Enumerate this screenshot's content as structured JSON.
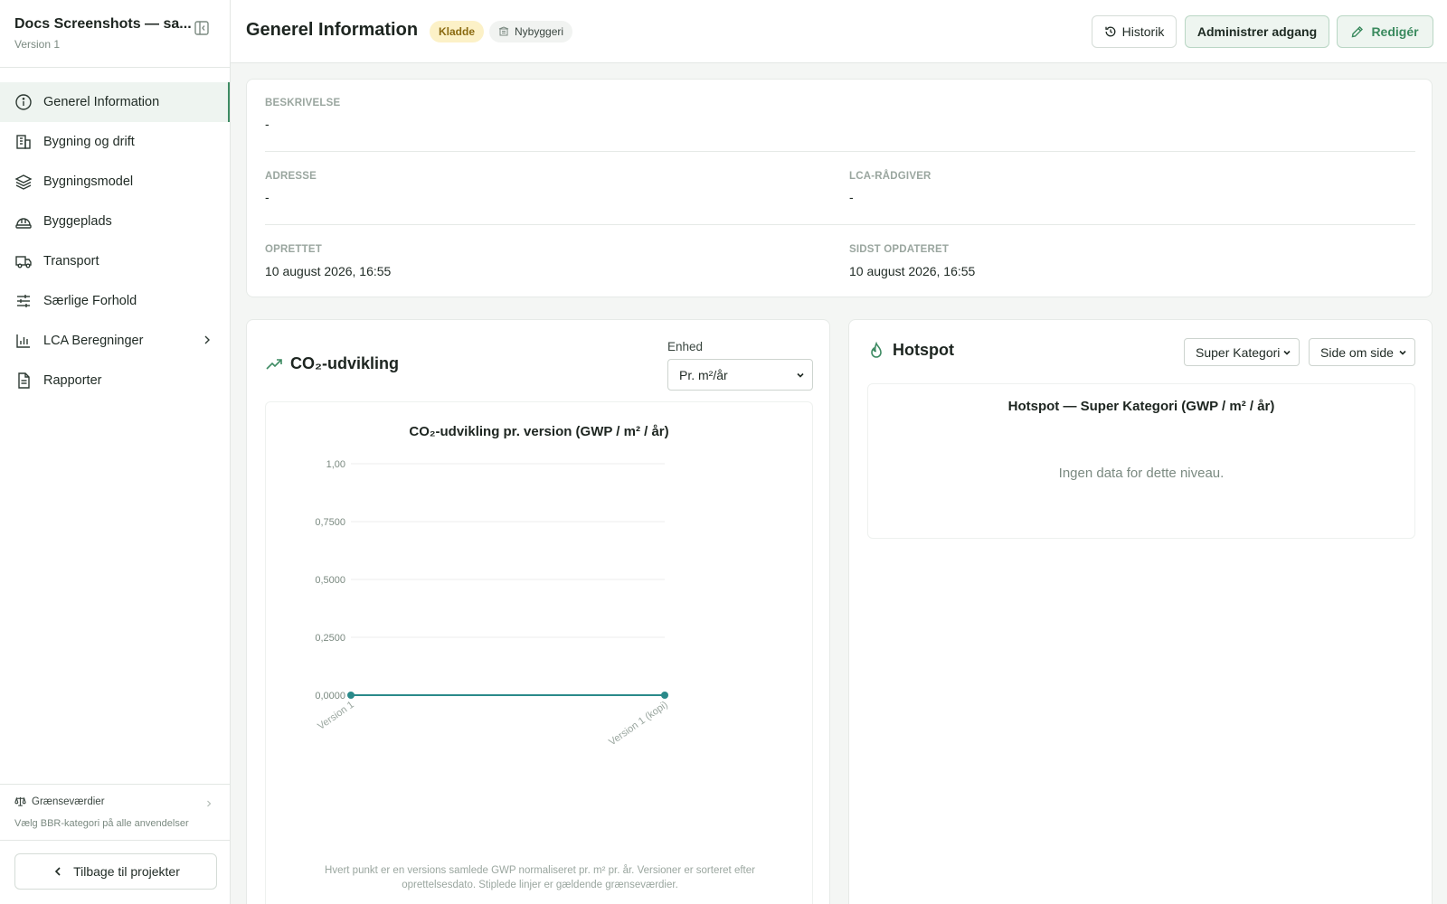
{
  "sidebar": {
    "project_title": "Docs Screenshots — sa...",
    "version": "Version 1",
    "items": [
      {
        "label": "Generel Information",
        "icon": "info-icon",
        "active": true
      },
      {
        "label": "Bygning og drift",
        "icon": "building-icon"
      },
      {
        "label": "Bygningsmodel",
        "icon": "layers-icon"
      },
      {
        "label": "Byggeplads",
        "icon": "hardhat-icon"
      },
      {
        "label": "Transport",
        "icon": "truck-icon"
      },
      {
        "label": "Særlige Forhold",
        "icon": "sliders-icon"
      },
      {
        "label": "LCA Beregninger",
        "icon": "bar-chart-icon",
        "has_children": true
      },
      {
        "label": "Rapporter",
        "icon": "document-icon"
      }
    ],
    "limits": {
      "title": "Grænseværdier",
      "subtitle": "Vælg BBR-kategori på alle anvendelser"
    },
    "back_label": "Tilbage til projekter"
  },
  "header": {
    "title": "Generel Information",
    "status_badge": "Kladde",
    "type_badge": "Nybyggeri",
    "history_label": "Historik",
    "access_label": "Administrer adgang",
    "edit_label": "Redigér"
  },
  "info": {
    "description_label": "BESKRIVELSE",
    "description_value": "-",
    "address_label": "ADRESSE",
    "address_value": "-",
    "advisor_label": "LCA-RÅDGIVER",
    "advisor_value": "-",
    "created_label": "OPRETTET",
    "created_value": "10 august 2026, 16:55",
    "updated_label": "SIDST OPDATERET",
    "updated_value": "10 august 2026, 16:55"
  },
  "co2": {
    "title": "CO₂-udvikling",
    "unit_label": "Enhed",
    "unit_value": "Pr. m²/år",
    "note": "Hvert punkt er en versions samlede GWP normaliseret pr. m² pr. år. Versioner er sorteret efter oprettelsesdato. Stiplede linjer er gældende grænseværdier."
  },
  "chart_data": {
    "type": "line",
    "title": "CO₂-udvikling pr. version (GWP / m² / år)",
    "categories": [
      "Version 1",
      "Version 1 (kopi)"
    ],
    "series": [
      {
        "values": [
          0,
          0
        ]
      }
    ],
    "ylim": [
      0,
      1
    ],
    "yticks": [
      "0,0000",
      "0,2500",
      "0,5000",
      "0,7500",
      "1,00"
    ],
    "ytick_values": [
      0,
      0.25,
      0.5,
      0.75,
      1
    ],
    "grid": true,
    "line_color": "#2a8a8a"
  },
  "hotspot": {
    "title": "Hotspot",
    "category_select": "Super Kategori",
    "layout_select": "Side om side",
    "chart_title": "Hotspot — Super Kategori (GWP / m² / år)",
    "empty_text": "Ingen data for dette niveau."
  },
  "colors": {
    "accent": "#3e8b63",
    "draft_badge_bg": "#fcf1c7"
  }
}
